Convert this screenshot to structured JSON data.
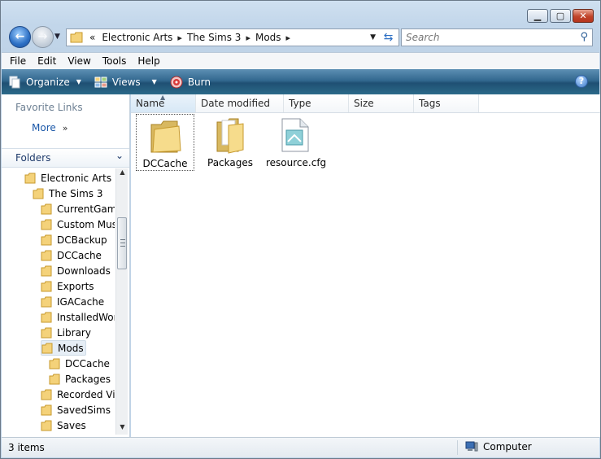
{
  "window": {
    "minimize_glyph": "▁",
    "maximize_glyph": "▢",
    "close_glyph": "✕"
  },
  "address_bar": {
    "overflow_glyph": "«",
    "breadcrumbs": [
      "Electronic Arts",
      "The Sims 3",
      "Mods"
    ],
    "search_placeholder": "Search"
  },
  "menu": [
    "File",
    "Edit",
    "View",
    "Tools",
    "Help"
  ],
  "command_bar": {
    "organize": "Organize",
    "views": "Views",
    "burn": "Burn",
    "help_glyph": "?"
  },
  "navigation_pane": {
    "favorite_links_title": "Favorite Links",
    "more_label": "More",
    "more_glyph": "»",
    "folders_title": "Folders",
    "tree": [
      {
        "label": "Electronic Arts",
        "level": 0
      },
      {
        "label": "The Sims 3",
        "level": 1
      },
      {
        "label": "CurrentGame",
        "level": 2
      },
      {
        "label": "Custom Musi",
        "level": 2
      },
      {
        "label": "DCBackup",
        "level": 2
      },
      {
        "label": "DCCache",
        "level": 2
      },
      {
        "label": "Downloads",
        "level": 2
      },
      {
        "label": "Exports",
        "level": 2
      },
      {
        "label": "IGACache",
        "level": 2
      },
      {
        "label": "InstalledWorl",
        "level": 2
      },
      {
        "label": "Library",
        "level": 2
      },
      {
        "label": "Mods",
        "level": 2,
        "selected": true
      },
      {
        "label": "DCCache",
        "level": 3
      },
      {
        "label": "Packages",
        "level": 3
      },
      {
        "label": "Recorded Vid",
        "level": 2
      },
      {
        "label": "SavedSims",
        "level": 2
      },
      {
        "label": "Saves",
        "level": 2
      }
    ]
  },
  "columns": [
    "Name",
    "Date modified",
    "Type",
    "Size",
    "Tags"
  ],
  "files": [
    {
      "name": "DCCache",
      "kind": "folder-closed"
    },
    {
      "name": "Packages",
      "kind": "folder-open"
    },
    {
      "name": "resource.cfg",
      "kind": "config-file"
    }
  ],
  "status_bar": {
    "item_count": "3 items",
    "location": "Computer"
  }
}
